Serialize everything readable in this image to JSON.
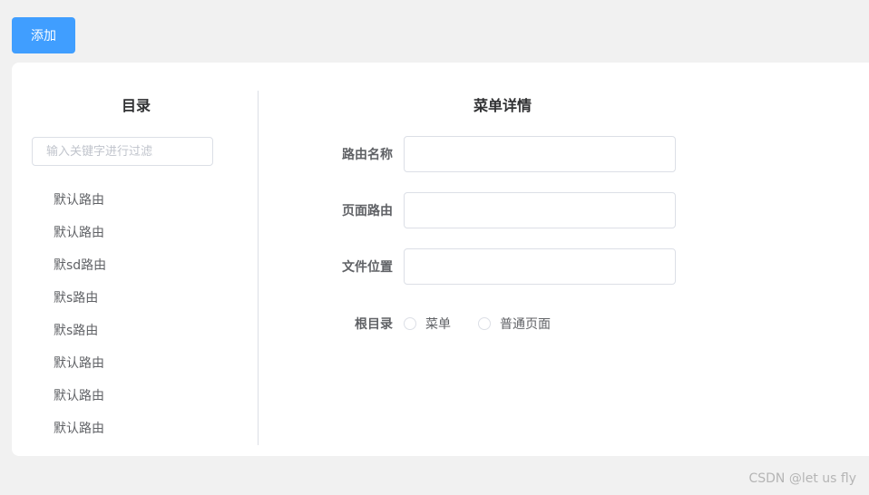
{
  "toolbar": {
    "add_label": "添加"
  },
  "tree_panel": {
    "title": "目录",
    "filter_placeholder": "输入关键字进行过滤",
    "items": [
      "默认路由",
      "默认路由",
      "默sd路由",
      "默s路由",
      "默s路由",
      "默认路由",
      "默认路由",
      "默认路由"
    ]
  },
  "detail": {
    "title": "菜单详情",
    "fields": {
      "route_name": "路由名称",
      "page_route": "页面路由",
      "file_location": "文件位置",
      "root": "根目录"
    },
    "radio_options": [
      "菜单",
      "普通页面"
    ]
  },
  "watermark": "CSDN @let us fly"
}
